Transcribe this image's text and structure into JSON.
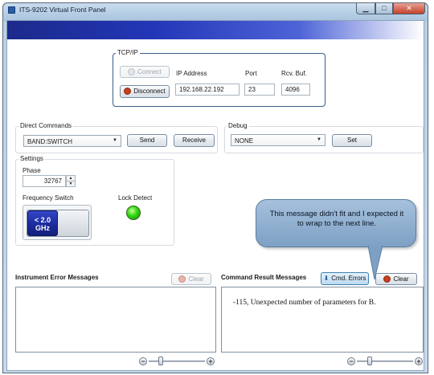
{
  "window": {
    "title": "ITS-9202 Virtual Front Panel"
  },
  "tcpip": {
    "group_label": "TCP/IP",
    "connect_label": "Connect",
    "disconnect_label": "Disconnect",
    "ip_label": "IP Address",
    "port_label": "Port",
    "rcv_label": "Rcv. Buf.",
    "ip_value": "192.168.22.192",
    "port_value": "23",
    "rcv_value": "4096"
  },
  "direct": {
    "group_label": "Direct Commands",
    "command_value": "BAND:SWITCH",
    "send_label": "Send",
    "receive_label": "Receive"
  },
  "debug": {
    "group_label": "Debug",
    "level_value": "NONE",
    "set_label": "Set"
  },
  "settings": {
    "group_label": "Settings",
    "phase_label": "Phase",
    "phase_value": "32767",
    "freq_label": "Frequency Switch",
    "freq_button_line1": "< 2.0",
    "freq_button_line2": "GHz",
    "lock_label": "Lock Detect",
    "lock_color": "#2fd60f"
  },
  "instrument_errors": {
    "title": "Instrument Error Messages",
    "clear_label": "Clear"
  },
  "command_results": {
    "title": "Command Result Messages",
    "cmd_errors_label": "Cmd. Errors",
    "clear_label": "Clear",
    "message": "-115, Unexpected number of parameters for B."
  },
  "callout": {
    "text": "This message didn't fit and I expected it to wrap to the next line."
  },
  "zoom": {
    "minus": "−",
    "plus": "+"
  },
  "colors": {
    "header_start": "#1b2a8a",
    "header_end": "#ffffff",
    "freq_button": "#1a2a9a",
    "disconnect_icon": "#c8401c"
  }
}
